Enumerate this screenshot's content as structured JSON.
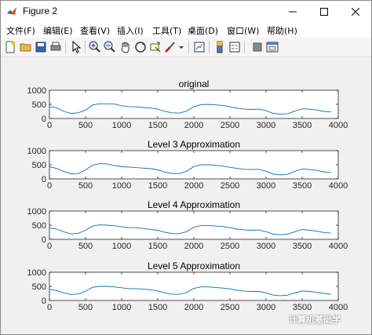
{
  "window": {
    "title": "Figure 2"
  },
  "menu": [
    "文件(F)",
    "编辑(E)",
    "查看(V)",
    "插入(I)",
    "工具(T)",
    "桌面(D)",
    "窗口(W)",
    "帮助(H)"
  ],
  "toolbar": [
    "new-figure-icon",
    "open-file-icon",
    "save-icon",
    "print-icon",
    "pointer-icon",
    "zoom-in-icon",
    "zoom-out-icon",
    "pan-icon",
    "rotate-3d-icon",
    "data-cursor-icon",
    "brush-icon",
    "dropdown-icon",
    "link-plot-icon",
    "colorbar-icon",
    "legend-icon",
    "hide-plot-tools-icon",
    "show-plot-tools-icon"
  ],
  "colors": {
    "line": "#0072bd",
    "axes": "#262626",
    "background": "#f0f0f0"
  },
  "chart_data": [
    {
      "type": "line",
      "title": "original",
      "xlim": [
        0,
        4000
      ],
      "ylim": [
        0,
        1000
      ],
      "xticks": [
        "0",
        "500",
        "1000",
        "1500",
        "2000",
        "2500",
        "3000",
        "3500",
        "4000"
      ],
      "yticks": [
        "0",
        "500",
        "1000"
      ],
      "x": [
        0,
        100,
        200,
        300,
        400,
        500,
        600,
        700,
        800,
        900,
        1000,
        1100,
        1200,
        1300,
        1400,
        1500,
        1600,
        1700,
        1800,
        1900,
        2000,
        2100,
        2200,
        2300,
        2400,
        2500,
        2600,
        2700,
        2800,
        2900,
        3000,
        3100,
        3200,
        3300,
        3400,
        3500,
        3600,
        3700,
        3800,
        3900
      ],
      "y": [
        420,
        380,
        250,
        180,
        200,
        300,
        480,
        520,
        520,
        510,
        450,
        420,
        410,
        390,
        370,
        330,
        250,
        200,
        190,
        260,
        420,
        490,
        500,
        480,
        460,
        420,
        360,
        330,
        320,
        330,
        280,
        180,
        150,
        170,
        260,
        340,
        330,
        300,
        250,
        230
      ]
    },
    {
      "type": "line",
      "title": "Level 3 Approximation",
      "xlim": [
        0,
        4000
      ],
      "ylim": [
        0,
        1000
      ],
      "xticks": [
        "0",
        "500",
        "1000",
        "1500",
        "2000",
        "2500",
        "3000",
        "3500",
        "4000"
      ],
      "yticks": [
        "0",
        "500",
        "1000"
      ],
      "x": [
        0,
        100,
        200,
        300,
        400,
        500,
        600,
        700,
        800,
        900,
        1000,
        1100,
        1200,
        1300,
        1400,
        1500,
        1600,
        1700,
        1800,
        1900,
        2000,
        2100,
        2200,
        2300,
        2400,
        2500,
        2600,
        2700,
        2800,
        2900,
        3000,
        3100,
        3200,
        3300,
        3400,
        3500,
        3600,
        3700,
        3800,
        3900
      ],
      "y": [
        430,
        370,
        260,
        180,
        190,
        320,
        490,
        540,
        530,
        470,
        430,
        420,
        400,
        380,
        360,
        320,
        240,
        190,
        190,
        270,
        440,
        500,
        500,
        480,
        450,
        410,
        370,
        340,
        330,
        340,
        270,
        170,
        140,
        160,
        270,
        350,
        330,
        300,
        250,
        220
      ]
    },
    {
      "type": "line",
      "title": "Level 4 Approximation",
      "xlim": [
        0,
        4000
      ],
      "ylim": [
        0,
        1000
      ],
      "xticks": [
        "0",
        "500",
        "1000",
        "1500",
        "2000",
        "2500",
        "3000",
        "3500",
        "4000"
      ],
      "yticks": [
        "0",
        "500",
        "1000"
      ],
      "x": [
        0,
        100,
        200,
        300,
        400,
        500,
        600,
        700,
        800,
        900,
        1000,
        1100,
        1200,
        1300,
        1400,
        1500,
        1600,
        1700,
        1800,
        1900,
        2000,
        2100,
        2200,
        2300,
        2400,
        2500,
        2600,
        2700,
        2800,
        2900,
        3000,
        3100,
        3200,
        3300,
        3400,
        3500,
        3600,
        3700,
        3800,
        3900
      ],
      "y": [
        400,
        360,
        260,
        190,
        210,
        320,
        470,
        510,
        500,
        480,
        440,
        420,
        410,
        380,
        350,
        320,
        250,
        200,
        200,
        270,
        430,
        490,
        490,
        470,
        450,
        410,
        360,
        330,
        320,
        330,
        270,
        180,
        160,
        180,
        270,
        350,
        320,
        290,
        240,
        220
      ]
    },
    {
      "type": "line",
      "title": "Level 5 Approximation",
      "xlim": [
        0,
        4000
      ],
      "ylim": [
        0,
        1000
      ],
      "xticks": [
        "0",
        "500",
        "1000",
        "1500",
        "2000",
        "2500",
        "3000",
        "3500",
        "4000"
      ],
      "yticks": [
        "0",
        "500",
        "1000"
      ],
      "x": [
        0,
        100,
        200,
        300,
        400,
        500,
        600,
        700,
        800,
        900,
        1000,
        1100,
        1200,
        1300,
        1400,
        1500,
        1600,
        1700,
        1800,
        1900,
        2000,
        2100,
        2200,
        2300,
        2400,
        2500,
        2600,
        2700,
        2800,
        2900,
        3000,
        3100,
        3200,
        3300,
        3400,
        3500,
        3600,
        3700,
        3800,
        3900
      ],
      "y": [
        400,
        350,
        270,
        210,
        230,
        330,
        470,
        500,
        500,
        480,
        450,
        420,
        420,
        400,
        380,
        340,
        270,
        220,
        220,
        280,
        430,
        480,
        480,
        460,
        440,
        410,
        360,
        330,
        320,
        320,
        270,
        190,
        170,
        190,
        270,
        340,
        320,
        290,
        250,
        220
      ]
    }
  ],
  "watermark": "计算机基础学"
}
